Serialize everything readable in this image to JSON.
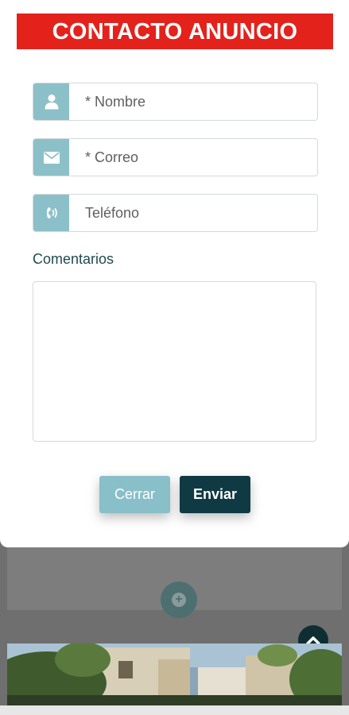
{
  "modal": {
    "title": "CONTACTO ANUNCIO",
    "fields": [
      {
        "placeholder": "* Nombre",
        "icon": "user-icon"
      },
      {
        "placeholder": "* Correo",
        "icon": "envelope-icon"
      },
      {
        "placeholder": "Teléfono",
        "icon": "phone-icon"
      }
    ],
    "comments_label": "Comentarios",
    "comments_value": "",
    "buttons": {
      "close": "Cerrar",
      "send": "Enviar"
    }
  },
  "background": {
    "add_icon": "plus-circle-icon",
    "scroll_icon": "chevron-up-icon"
  },
  "colors": {
    "title_bg": "#e3221c",
    "icon_box": "#8cc0c9",
    "send_button": "#0f3a44",
    "close_button": "#89bfc8"
  }
}
